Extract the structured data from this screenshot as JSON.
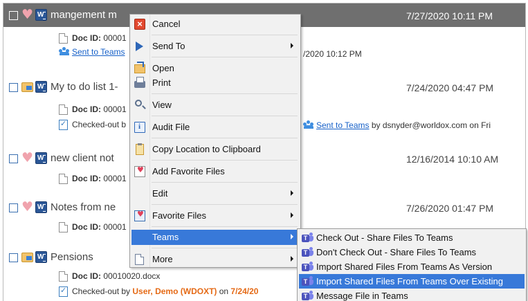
{
  "rows": [
    {
      "title": "mangement m",
      "date": "7/27/2020 10:11 PM",
      "doc_id_label": "Doc ID:",
      "doc_id": "00001",
      "link_sent": "Sent",
      "link_to": "to",
      "link_teams": "Teams",
      "right_text": "/2020 10:12 PM"
    },
    {
      "title": "My to do list 1-",
      "date": "7/24/2020 04:47 PM",
      "doc_id_label": "Doc ID:",
      "doc_id": "00001",
      "checked_out_text": "Checked-out b",
      "right_sent": "Sent",
      "right_to": "to",
      "right_teams": "Teams",
      "right_tail": " by dsnyder@worldox.com on Fri"
    },
    {
      "title": "new client not",
      "date": "12/16/2014 10:10 AM",
      "doc_id_label": "Doc ID:",
      "doc_id": "00001"
    },
    {
      "title": "Notes from ne",
      "date": "7/26/2020 01:47 PM",
      "doc_id_label": "Doc ID:",
      "doc_id": "00001"
    },
    {
      "title": "Pensions",
      "doc_id_label": "Doc ID:",
      "doc_id": "00010020.docx",
      "checked_out_prefix": "Checked-out by ",
      "checked_out_user": "User, Demo (WDOXT)",
      "checked_out_on": " on ",
      "checked_out_date": "7/24/20"
    }
  ],
  "context_menu": {
    "cancel": "Cancel",
    "send_to": "Send To",
    "open": "Open",
    "print": "Print",
    "view": "View",
    "audit_file": "Audit File",
    "copy_location": "Copy Location to Clipboard",
    "add_favorite": "Add Favorite Files",
    "edit": "Edit",
    "favorite_files": "Favorite Files",
    "teams": "Teams",
    "more": "More"
  },
  "teams_submenu": [
    "Check Out - Share Files To Teams",
    "Don't Check Out - Share Files To Teams",
    "Import Shared Files From Teams As Version",
    "Import Shared Files From Teams Over Existing",
    "Message File in Teams"
  ],
  "icons": {
    "favorite": "heart-icon",
    "checked_out": "folder-lock-icon",
    "word": "word-doc-icon",
    "teams": "teams-icon"
  },
  "colors": {
    "selected_row": "#6f6f6f",
    "menu_highlight": "#3879d9",
    "link": "#1660c8",
    "checked_out_user": "#e56a16",
    "teams": "#4b53bc"
  }
}
